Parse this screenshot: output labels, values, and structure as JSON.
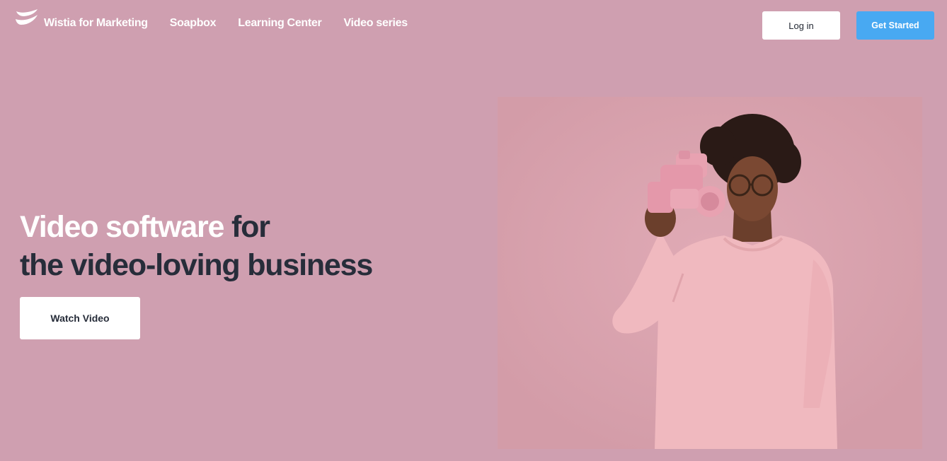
{
  "brand": {
    "logo_icon": "wistia-logo-icon",
    "accent_color": "#48a9f2",
    "background_color": "#cf9fb0"
  },
  "nav": {
    "items": [
      {
        "label": "Wistia for Marketing"
      },
      {
        "label": "Soapbox"
      },
      {
        "label": "Learning Center"
      },
      {
        "label": "Video series"
      }
    ]
  },
  "header": {
    "login_label": "Log in",
    "get_started_label": "Get Started"
  },
  "hero": {
    "headline_highlight": "Video software",
    "headline_rest_1": " for",
    "headline_line_2": "the video-loving business",
    "watch_video_label": "Watch Video"
  }
}
